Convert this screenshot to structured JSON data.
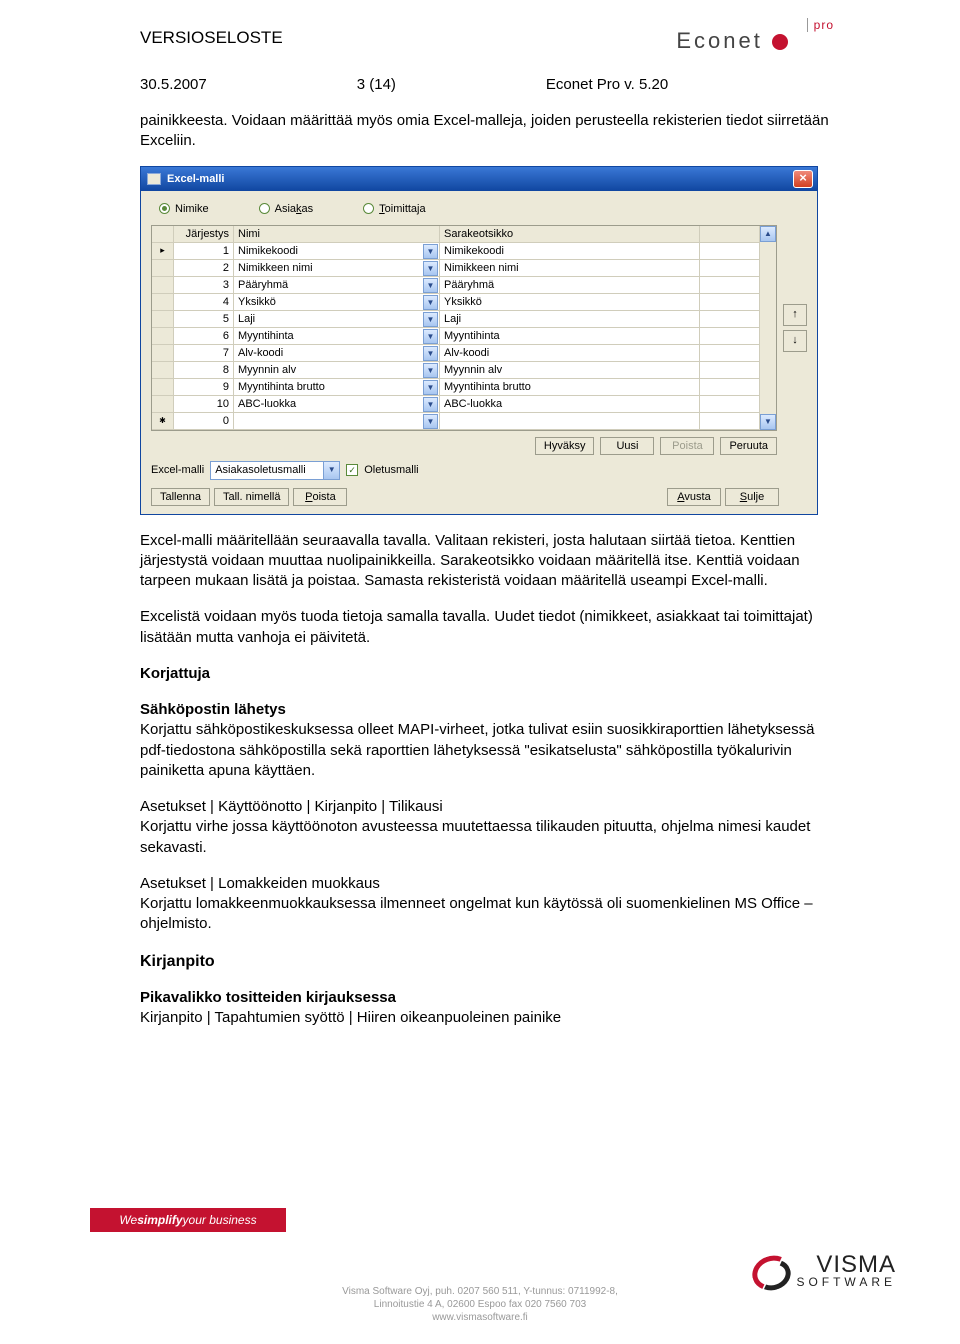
{
  "header": {
    "doc_title": "VERSIOSELOSTE",
    "econet": "Econet",
    "econet_pro": "pro"
  },
  "meta": {
    "date": "30.5.2007",
    "page": "3 (14)",
    "product": "Econet Pro v. 5.20"
  },
  "intro": "painikkeesta. Voidaan määrittää myös omia Excel-malleja, joiden perusteella rekisterien tiedot siirretään Exceliin.",
  "win": {
    "title": "Excel-malli",
    "radios": {
      "r1": "Nimike",
      "r2": "Asiakas",
      "r3": "Toimittaja"
    },
    "cols": {
      "c1": "Järjestys",
      "c2": "Nimi",
      "c3": "Sarakeotsikko"
    },
    "rows": [
      {
        "ord": "1",
        "name": "Nimikekoodi",
        "head": "Nimikekoodi"
      },
      {
        "ord": "2",
        "name": "Nimikkeen nimi",
        "head": "Nimikkeen nimi"
      },
      {
        "ord": "3",
        "name": "Pääryhmä",
        "head": "Pääryhmä"
      },
      {
        "ord": "4",
        "name": "Yksikkö",
        "head": "Yksikkö"
      },
      {
        "ord": "5",
        "name": "Laji",
        "head": "Laji"
      },
      {
        "ord": "6",
        "name": "Myyntihinta",
        "head": "Myyntihinta"
      },
      {
        "ord": "7",
        "name": "Alv-koodi",
        "head": "Alv-koodi"
      },
      {
        "ord": "8",
        "name": "Myynnin alv",
        "head": "Myynnin alv"
      },
      {
        "ord": "9",
        "name": "Myyntihinta brutto",
        "head": "Myyntihinta brutto"
      },
      {
        "ord": "10",
        "name": "ABC-luokka",
        "head": "ABC-luokka"
      },
      {
        "ord": "0",
        "name": "",
        "head": ""
      }
    ],
    "btns": {
      "hyvaksy": "Hyväksy",
      "uusi": "Uusi",
      "poista": "Poista",
      "peruuta": "Peruuta",
      "tallenna": "Tallenna",
      "tallnimella": "Tall. nimellä",
      "poista2": "Poista",
      "avusta": "Avusta",
      "sulje": "Sulje"
    },
    "midlabel": "Excel-malli",
    "combo_val": "Asiakasoletusmalli",
    "chk_label": "Oletusmalli"
  },
  "p1": "Excel-malli määritellään seuraavalla tavalla. Valitaan rekisteri, josta halutaan siirtää tietoa. Kenttien järjestystä voidaan muuttaa nuolipainikkeilla. Sarakeotsikko voidaan määritellä itse. Kenttiä voidaan tarpeen mukaan lisätä ja poistaa. Samasta rekisteristä voidaan määritellä useampi Excel-malli.",
  "p2": "Excelistä voidaan myös tuoda tietoja samalla tavalla. Uudet tiedot (nimikkeet, asiakkaat tai toimittajat) lisätään mutta vanhoja ei päivitetä.",
  "h_korj": "Korjattuja",
  "h_sahk": "Sähköpostin lähetys",
  "p3": "Korjattu sähköpostikeskuksessa olleet MAPI-virheet, jotka tulivat esiin suosikkiraporttien lähetyksessä pdf-tiedostona sähköpostilla sekä raporttien lähetyksessä \"esikatselusta\" sähköpostilla työkalurivin painiketta apuna käyttäen.",
  "p4a": "Asetukset | Käyttöönotto | Kirjanpito | Tilikausi",
  "p4b": "Korjattu virhe jossa käyttöönoton avusteessa muutettaessa tilikauden pituutta, ohjelma nimesi kaudet sekavasti.",
  "p5a": "Asetukset | Lomakkeiden muokkaus",
  "p5b": "Korjattu lomakkeenmuokkauksessa ilmenneet ongelmat kun käytössä oli suomenkielinen MS Office –ohjelmisto.",
  "h_kirj": "Kirjanpito",
  "h_pika": "Pikavalikko tositteiden kirjauksessa",
  "p6": "Kirjanpito | Tapahtumien syöttö | Hiiren oikeanpuoleinen painike",
  "footer": {
    "tag_pre": "We ",
    "tag_b": "simplify",
    "tag_post": " your business",
    "visma": "VISMA",
    "soft": "SOFTWARE",
    "line1": "Visma Software Oyj, puh. 0207 560 511, Y-tunnus: 0711992-8,",
    "line2": "Linnoitustie 4 A, 02600 Espoo  fax 020 7560 703",
    "line3": "www.vismasoftware.fi"
  }
}
